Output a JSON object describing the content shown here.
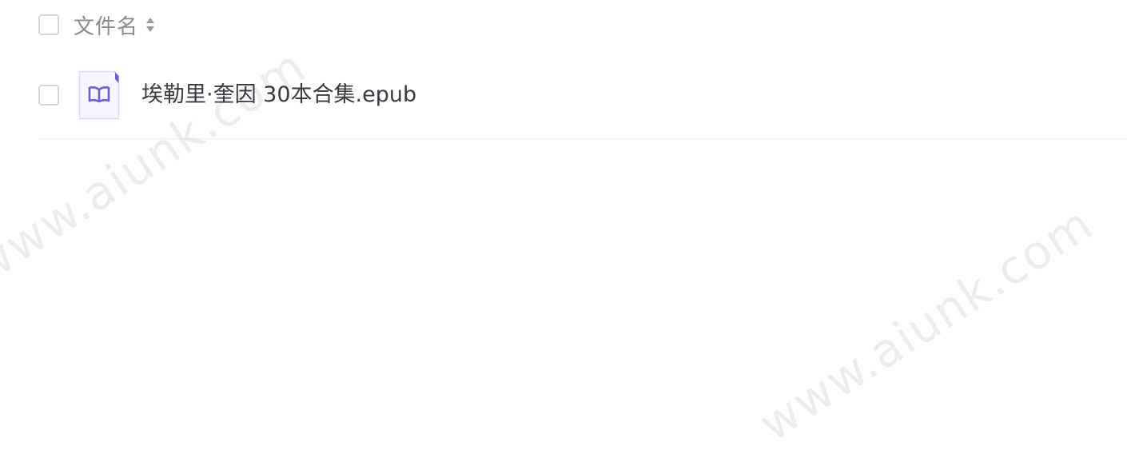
{
  "header": {
    "column_label": "文件名",
    "sort_icon": "sort-updown-icon"
  },
  "files": [
    {
      "name": "埃勒里·奎因 30本合集.epub",
      "icon": "book-open-icon",
      "icon_color": "#6b5fd3"
    }
  ],
  "watermark": {
    "text_1": "www.aiunk.com",
    "text_2": "www.aiunk.com"
  },
  "colors": {
    "accent": "#6b5fd3",
    "text": "#3a3a40",
    "muted": "#8a8a8e",
    "border": "#d4d4d8"
  }
}
